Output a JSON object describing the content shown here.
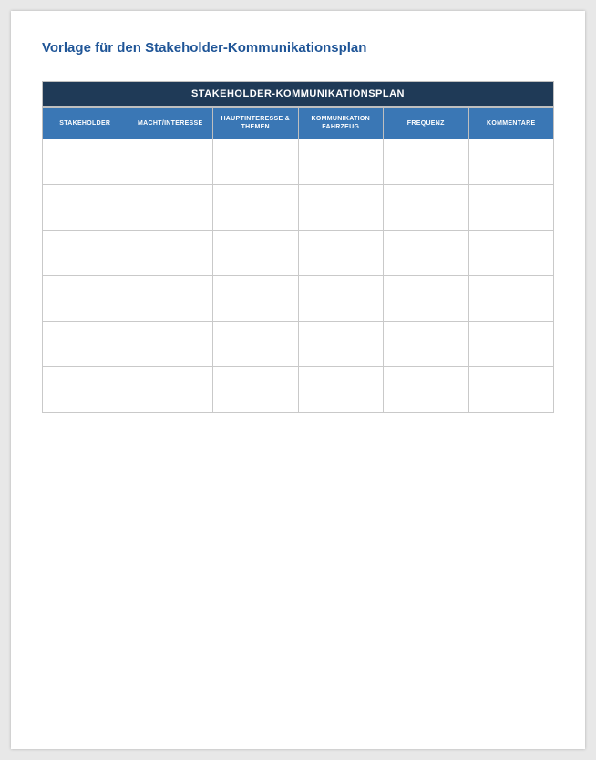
{
  "title": "Vorlage für den Stakeholder-Kommunikationsplan",
  "banner": "STAKEHOLDER-KOMMUNIKATIONSPLAN",
  "columns": [
    "STAKEHOLDER",
    "MACHT/INTERESSE",
    "HAUPTINTERESSE & THEMEN",
    "KOMMUNIKATION FAHRZEUG",
    "FREQUENZ",
    "KOMMENTARE"
  ],
  "rows": [
    [
      "",
      "",
      "",
      "",
      "",
      ""
    ],
    [
      "",
      "",
      "",
      "",
      "",
      ""
    ],
    [
      "",
      "",
      "",
      "",
      "",
      ""
    ],
    [
      "",
      "",
      "",
      "",
      "",
      ""
    ],
    [
      "",
      "",
      "",
      "",
      "",
      ""
    ],
    [
      "",
      "",
      "",
      "",
      "",
      ""
    ]
  ]
}
